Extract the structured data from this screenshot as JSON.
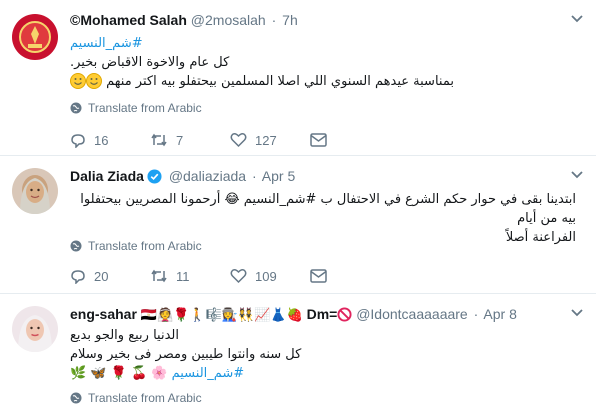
{
  "tweets": [
    {
      "fullname": "©Mohamed Salah",
      "screenname": "@2mosalah",
      "dot": "·",
      "time": "7h",
      "verified": false,
      "lines": [
        "#شم_النسيم",
        "كل عام والاخوة الاقباض بخير.",
        "بمناسبة عيدهم السنوي اللي اصلا المسلمين بيحتفلو بيه اكتر منهم"
      ],
      "translate": "Translate from Arabic",
      "replies": "16",
      "retweets": "7",
      "likes": "127"
    },
    {
      "fullname": "Dalia Ziada",
      "screenname": "@daliaziada",
      "dot": "·",
      "time": "Apr 5",
      "verified": true,
      "lines": [
        "ابتدينا بقى في حوار حكم الشرع في الاحتفال ب #شم_النسيم 😂 أرحمونا المصريين بيحتفلوا بيه من أيام",
        "الفراعنة أصلاً"
      ],
      "translate": "Translate from Arabic",
      "replies": "20",
      "retweets": "11",
      "likes": "109"
    },
    {
      "fullname": "eng-sahar",
      "name_emoji": "🇪🇬👰🌹🚶🎼👩‍🏭👯📈👗🍓",
      "name_suffix": "Dm=",
      "screenname": "@Idontcaaaaaare",
      "dot": "·",
      "time": "Apr 8",
      "verified": false,
      "lines": [
        "الدنيا ربيع والجو بديع",
        "كل سنه وانتوا طيبين ومصر فى بخير وسلام",
        "#شم_النسيم 🌸 🍒 🌹 🦋 🌿"
      ],
      "translate": "Translate from Arabic"
    }
  ],
  "icons": {
    "reply": "reply-icon",
    "retweet": "retweet-icon",
    "like": "heart-icon",
    "dm": "envelope-icon",
    "globe": "globe-icon",
    "caret": "chevron-down-icon",
    "verified": "verified-badge-icon",
    "no_entry": "no-entry-icon"
  },
  "colors": {
    "link": "#1b95e0",
    "secondary": "#657786",
    "verified": "#1da1f2",
    "divider": "#e6ecf0"
  }
}
